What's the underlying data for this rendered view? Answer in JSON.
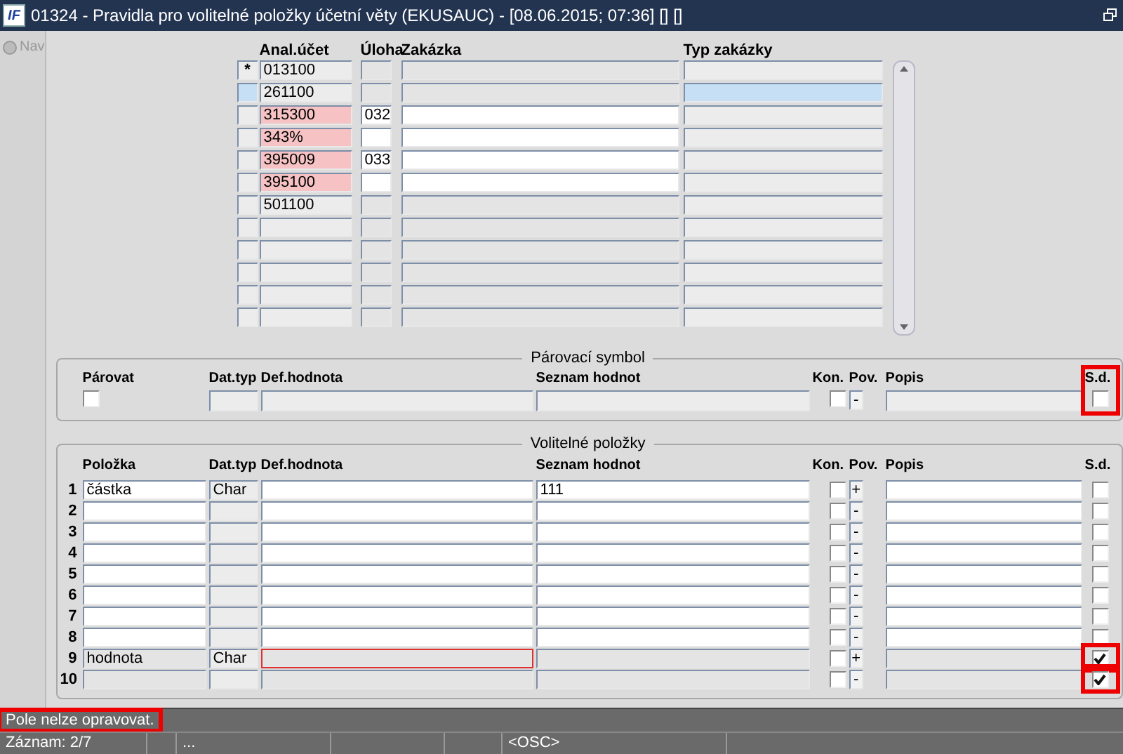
{
  "window": {
    "logo": "IF",
    "title": "01324 - Pravidla pro volitelné položky účetní věty (EKUSAUC) - [08.06.2015; 07:36] [] []"
  },
  "sidebar": {
    "items": [
      {
        "label": "Nav",
        "selected": false
      }
    ]
  },
  "grid": {
    "columns": [
      "Anal.účet",
      "Úloha",
      "Zakázka",
      "Typ zakázky"
    ],
    "rows": [
      {
        "marker": "*",
        "selected": false,
        "account": "013100",
        "flagged": false,
        "task": "",
        "editable": false
      },
      {
        "marker": "",
        "selected": true,
        "account": "261100",
        "flagged": false,
        "task": "",
        "editable": false
      },
      {
        "marker": "",
        "selected": false,
        "account": "315300",
        "flagged": true,
        "task": "032",
        "editable": true
      },
      {
        "marker": "",
        "selected": false,
        "account": "343%",
        "flagged": true,
        "task": "",
        "editable": true
      },
      {
        "marker": "",
        "selected": false,
        "account": "395009",
        "flagged": true,
        "task": "033",
        "editable": true
      },
      {
        "marker": "",
        "selected": false,
        "account": "395100",
        "flagged": true,
        "task": "",
        "editable": true
      },
      {
        "marker": "",
        "selected": false,
        "account": "501100",
        "flagged": false,
        "task": "",
        "editable": false
      },
      {
        "marker": "",
        "selected": false,
        "account": "",
        "flagged": false,
        "task": "",
        "editable": false
      },
      {
        "marker": "",
        "selected": false,
        "account": "",
        "flagged": false,
        "task": "",
        "editable": false
      },
      {
        "marker": "",
        "selected": false,
        "account": "",
        "flagged": false,
        "task": "",
        "editable": false
      },
      {
        "marker": "",
        "selected": false,
        "account": "",
        "flagged": false,
        "task": "",
        "editable": false
      },
      {
        "marker": "",
        "selected": false,
        "account": "",
        "flagged": false,
        "task": "",
        "editable": false
      }
    ]
  },
  "pairing": {
    "title": "Párovací symbol",
    "columns": [
      "Párovat",
      "Dat.typ",
      "Def.hodnota",
      "Seznam hodnot",
      "Kon.",
      "Pov.",
      "Popis",
      "S.d."
    ],
    "pair_checked": false,
    "kon_checked": false,
    "pov": "-",
    "sd_checked": false,
    "sd_highlighted": true
  },
  "optional": {
    "title": "Volitelné položky",
    "columns": [
      "Položka",
      "Dat.typ",
      "Def.hodnota",
      "Seznam hodnot",
      "Kon.",
      "Pov.",
      "Popis",
      "S.d."
    ],
    "rows": [
      {
        "number": "1",
        "item": "částka",
        "type": "Char",
        "default": "",
        "list": "111",
        "kon": false,
        "pov": "+",
        "sd": false,
        "editable": true,
        "focused": false,
        "sd_highlighted": false
      },
      {
        "number": "2",
        "item": "",
        "type": "",
        "default": "",
        "list": "",
        "kon": false,
        "pov": "-",
        "sd": false,
        "editable": true,
        "focused": false,
        "sd_highlighted": false
      },
      {
        "number": "3",
        "item": "",
        "type": "",
        "default": "",
        "list": "",
        "kon": false,
        "pov": "-",
        "sd": false,
        "editable": true,
        "focused": false,
        "sd_highlighted": false
      },
      {
        "number": "4",
        "item": "",
        "type": "",
        "default": "",
        "list": "",
        "kon": false,
        "pov": "-",
        "sd": false,
        "editable": true,
        "focused": false,
        "sd_highlighted": false
      },
      {
        "number": "5",
        "item": "",
        "type": "",
        "default": "",
        "list": "",
        "kon": false,
        "pov": "-",
        "sd": false,
        "editable": true,
        "focused": false,
        "sd_highlighted": false
      },
      {
        "number": "6",
        "item": "",
        "type": "",
        "default": "",
        "list": "",
        "kon": false,
        "pov": "-",
        "sd": false,
        "editable": true,
        "focused": false,
        "sd_highlighted": false
      },
      {
        "number": "7",
        "item": "",
        "type": "",
        "default": "",
        "list": "",
        "kon": false,
        "pov": "-",
        "sd": false,
        "editable": true,
        "focused": false,
        "sd_highlighted": false
      },
      {
        "number": "8",
        "item": "",
        "type": "",
        "default": "",
        "list": "",
        "kon": false,
        "pov": "-",
        "sd": false,
        "editable": true,
        "focused": false,
        "sd_highlighted": false
      },
      {
        "number": "9",
        "item": "hodnota",
        "type": "Char",
        "default": "",
        "list": "",
        "kon": false,
        "pov": "+",
        "sd": true,
        "editable": false,
        "focused": true,
        "sd_highlighted": true
      },
      {
        "number": "10",
        "item": "",
        "type": "",
        "default": "",
        "list": "",
        "kon": false,
        "pov": "-",
        "sd": true,
        "editable": false,
        "focused": false,
        "sd_highlighted": true
      }
    ]
  },
  "message": {
    "text": "Pole nelze opravovat.",
    "highlighted": true
  },
  "status_bar": [
    "Záznam: 2/7",
    "...",
    "<OSC>"
  ]
}
